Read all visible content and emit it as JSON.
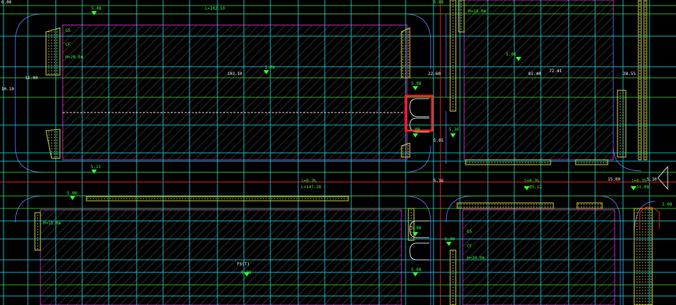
{
  "view": {
    "title": "",
    "colors": {
      "background": "#000000",
      "grid_cyan": "#1fd8e6",
      "grid_green": "#3ad43a",
      "axis_red": "#ff2020",
      "building_outline": "#cc2ccc",
      "curb_yellow": "#d8d84a",
      "road_edge": "#5a6ae0",
      "hatch_gray": "#5a5a5a",
      "text_green": "#33ff33",
      "text_white": "#ffffff",
      "selection_red": "#ff1a1a"
    }
  },
  "selection": {
    "label": "selected-entity-box"
  },
  "annotations": {
    "top_left_corner": "0.00",
    "top_mid": "5.08",
    "top_mid2": "L=102.10",
    "top_right": "5.08",
    "top_right2": "H=18.0m",
    "bldg1_a": "G5",
    "bldg1_b": "CF",
    "bldg1_c": "H=20.0m",
    "dim_left": "11.90",
    "dim_mid": "103.10",
    "dim_mid_right": "22.60",
    "dim_right": "81.40",
    "dim_right2": "72.41",
    "dim_far_right": "28.55",
    "left_axis": "10.10",
    "elev1": "5.08",
    "elev2": "5.08",
    "elev3": "5.08",
    "elev4": "5.08",
    "elev5": "5.05",
    "road_dim1": "5.16",
    "road_dim2": "5.13",
    "road_dim3": "5.16",
    "slope1": "i=0.3%",
    "slope1_len": "L=147.28",
    "slope2": "i=0.3%",
    "slope2_len": "L=95.12",
    "road_right": "15.00",
    "road_right2": "i=0.3%",
    "road_right3": "L=31.08",
    "far_right_elev": "5.10",
    "road_bottom_a": "5.08",
    "road_bottom_b": "5.08",
    "bldg3_a": "H=15.0m",
    "bldg3_b": "FS(T)",
    "bldg4_a": "G5",
    "bldg4_b": "CF",
    "bldg4_c": "H=20.0m",
    "elev_b1": "5.08",
    "elev_b2": "5.08",
    "elev_b3": "5.08",
    "bottom_mid": "5.08"
  }
}
